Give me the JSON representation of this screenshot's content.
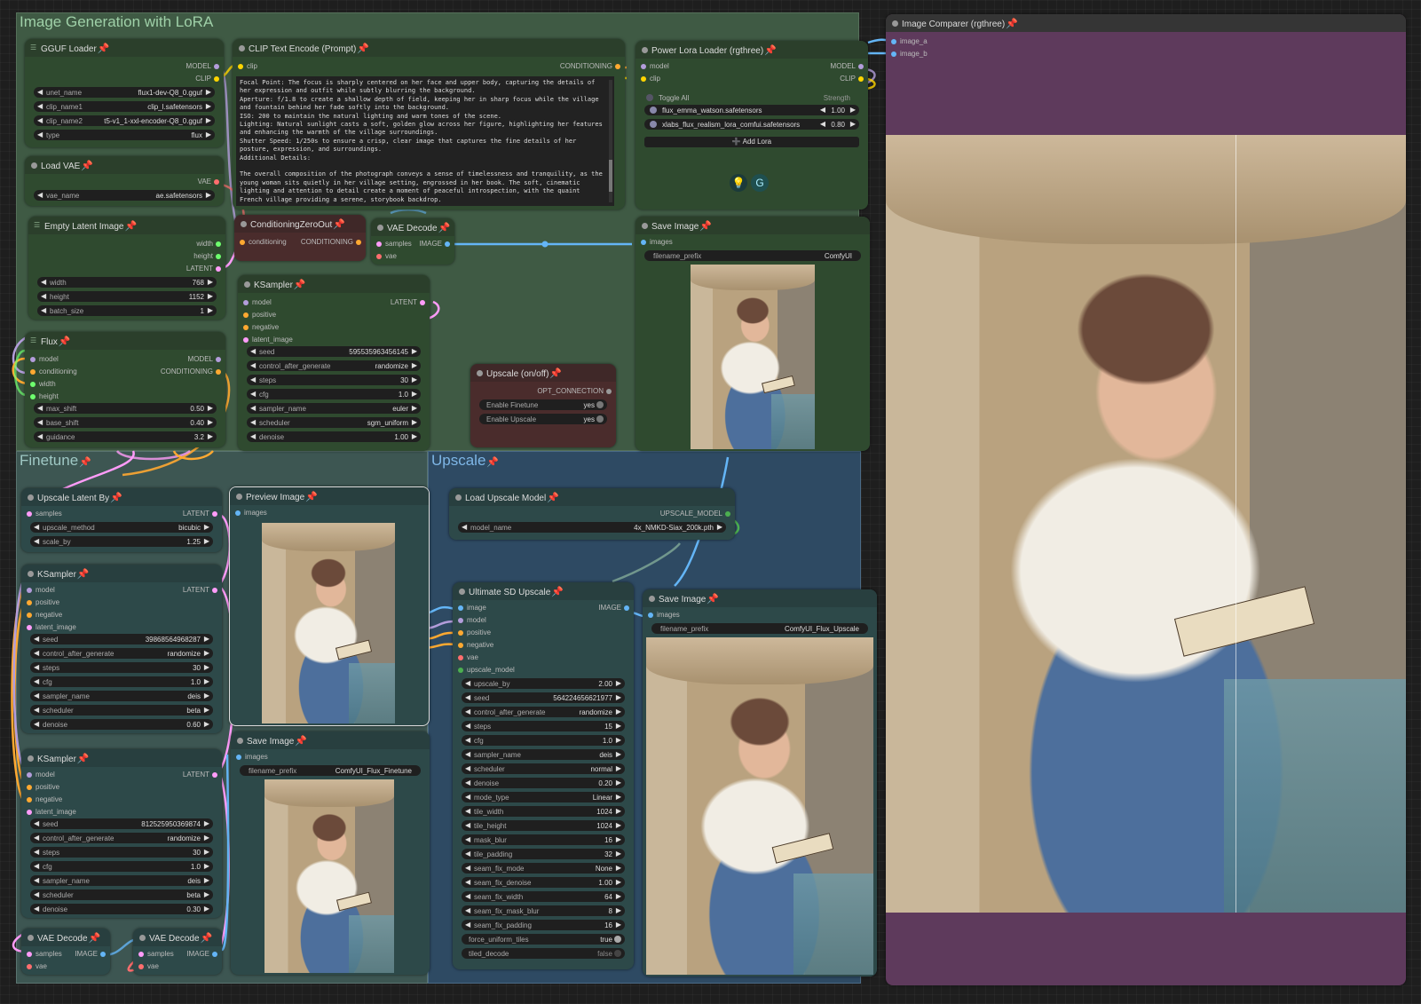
{
  "groups": {
    "main": {
      "title": "Image Generation with LoRA",
      "color": "#3f5a44"
    },
    "finetune": {
      "title": "Finetune",
      "color": "#3d5652"
    },
    "upscale": {
      "title": "Upscale",
      "color": "#2e4a63"
    }
  },
  "pin_icon": "pin-icon",
  "nodes": {
    "gguf": {
      "title": "GGUF Loader",
      "outputs": [
        "MODEL",
        "CLIP"
      ],
      "widgets": [
        {
          "k": "unet_name",
          "v": "flux1-dev-Q8_0.gguf"
        },
        {
          "k": "clip_name1",
          "v": "clip_l.safetensors"
        },
        {
          "k": "clip_name2",
          "v": "t5-v1_1-xxl-encoder-Q8_0.gguf"
        },
        {
          "k": "type",
          "v": "flux"
        }
      ]
    },
    "vae": {
      "title": "Load VAE",
      "outputs": [
        "VAE"
      ],
      "widgets": [
        {
          "k": "vae_name",
          "v": "ae.safetensors"
        }
      ]
    },
    "empty_latent": {
      "title": "Empty Latent Image",
      "outputs": [
        "width",
        "height",
        "LATENT"
      ],
      "widgets": [
        {
          "k": "width",
          "v": "768"
        },
        {
          "k": "height",
          "v": "1152"
        },
        {
          "k": "batch_size",
          "v": "1"
        }
      ]
    },
    "flux": {
      "title": "Flux",
      "inputs": [
        "model",
        "conditioning",
        "width",
        "height"
      ],
      "outputs": [
        "MODEL",
        "CONDITIONING"
      ],
      "widgets": [
        {
          "k": "max_shift",
          "v": "0.50"
        },
        {
          "k": "base_shift",
          "v": "0.40"
        },
        {
          "k": "guidance",
          "v": "3.2"
        }
      ]
    },
    "clip_text": {
      "title": "CLIP Text Encode (Prompt)",
      "input": "clip",
      "output": "CONDITIONING",
      "text": "Focal Point: The focus is sharply centered on her face and upper body, capturing the details of her expression and outfit while subtly blurring the background.\nAperture: f/1.8 to create a shallow depth of field, keeping her in sharp focus while the village and fountain behind her fade softly into the background.\nISO: 200 to maintain the natural lighting and warm tones of the scene.\nLighting: Natural sunlight casts a soft, golden glow across her figure, highlighting her features and enhancing the warmth of the village surroundings.\nShutter Speed: 1/250s to ensure a crisp, clear image that captures the fine details of her posture, expression, and surroundings.\nAdditional Details:\n\nThe overall composition of the photograph conveys a sense of timelessness and tranquility, as the young woman sits quietly in her village setting, engrossed in her book. The soft, cinematic lighting and attention to detail create a moment of peaceful introspection, with the quaint French village providing a serene, storybook backdrop."
    },
    "cond_zero": {
      "title": "ConditioningZeroOut",
      "input": "conditioning",
      "output": "CONDITIONING"
    },
    "vae_decode_main": {
      "title": "VAE Decode",
      "inputs": [
        "samples",
        "vae"
      ],
      "output": "IMAGE"
    },
    "ksampler_main": {
      "title": "KSampler",
      "inputs": [
        "model",
        "positive",
        "negative",
        "latent_image"
      ],
      "output": "LATENT",
      "widgets": [
        {
          "k": "seed",
          "v": "595535963456145"
        },
        {
          "k": "control_after_generate",
          "v": "randomize"
        },
        {
          "k": "steps",
          "v": "30"
        },
        {
          "k": "cfg",
          "v": "1.0"
        },
        {
          "k": "sampler_name",
          "v": "euler"
        },
        {
          "k": "scheduler",
          "v": "sgm_uniform"
        },
        {
          "k": "denoise",
          "v": "1.00"
        }
      ]
    },
    "upscale_switch": {
      "title": "Upscale (on/off)",
      "output": "OPT_CONNECTION",
      "widgets": [
        {
          "k": "Enable Finetune",
          "v": "yes"
        },
        {
          "k": "Enable Upscale",
          "v": "yes"
        }
      ]
    },
    "lora": {
      "title": "Power Lora Loader (rgthree)",
      "inputs": [
        "model",
        "clip"
      ],
      "outputs": [
        "MODEL",
        "CLIP"
      ],
      "toggle_all": "Toggle All",
      "strength_label": "Strength",
      "loras": [
        {
          "name": "flux_emma_watson.safetensors",
          "strength": "1.00"
        },
        {
          "name": "xlabs_flux_realism_lora_comfui.safetensors",
          "strength": "0.80"
        }
      ],
      "add_label": "➕ Add Lora"
    },
    "save_main": {
      "title": "Save Image",
      "input": "images",
      "widget": {
        "k": "filename_prefix",
        "v": "ComfyUI"
      }
    },
    "comparer": {
      "title": "Image Comparer (rgthree)",
      "inputs": [
        "image_a",
        "image_b"
      ]
    },
    "upscale_latent": {
      "title": "Upscale Latent By",
      "input": "samples",
      "output": "LATENT",
      "widgets": [
        {
          "k": "upscale_method",
          "v": "bicubic"
        },
        {
          "k": "scale_by",
          "v": "1.25"
        }
      ]
    },
    "ksampler_ft1": {
      "title": "KSampler",
      "inputs": [
        "model",
        "positive",
        "negative",
        "latent_image"
      ],
      "output": "LATENT",
      "widgets": [
        {
          "k": "seed",
          "v": "39868564968287"
        },
        {
          "k": "control_after_generate",
          "v": "randomize"
        },
        {
          "k": "steps",
          "v": "30"
        },
        {
          "k": "cfg",
          "v": "1.0"
        },
        {
          "k": "sampler_name",
          "v": "deis"
        },
        {
          "k": "scheduler",
          "v": "beta"
        },
        {
          "k": "denoise",
          "v": "0.60"
        }
      ]
    },
    "ksampler_ft2": {
      "title": "KSampler",
      "inputs": [
        "model",
        "positive",
        "negative",
        "latent_image"
      ],
      "output": "LATENT",
      "widgets": [
        {
          "k": "seed",
          "v": "812525950369874"
        },
        {
          "k": "control_after_generate",
          "v": "randomize"
        },
        {
          "k": "steps",
          "v": "30"
        },
        {
          "k": "cfg",
          "v": "1.0"
        },
        {
          "k": "sampler_name",
          "v": "deis"
        },
        {
          "k": "scheduler",
          "v": "beta"
        },
        {
          "k": "denoise",
          "v": "0.30"
        }
      ]
    },
    "vae_decode_ft1": {
      "title": "VAE Decode",
      "inputs": [
        "samples",
        "vae"
      ],
      "output": "IMAGE"
    },
    "vae_decode_ft2": {
      "title": "VAE Decode",
      "inputs": [
        "samples",
        "vae"
      ],
      "output": "IMAGE"
    },
    "preview": {
      "title": "Preview Image",
      "input": "images"
    },
    "save_ft": {
      "title": "Save Image",
      "input": "images",
      "widget": {
        "k": "filename_prefix",
        "v": "ComfyUI_Flux_Finetune"
      }
    },
    "load_upscale": {
      "title": "Load Upscale Model",
      "output": "UPSCALE_MODEL",
      "widget": {
        "k": "model_name",
        "v": "4x_NMKD-Siax_200k.pth"
      }
    },
    "ultimate": {
      "title": "Ultimate SD Upscale",
      "inputs": [
        "image",
        "model",
        "positive",
        "negative",
        "vae",
        "upscale_model"
      ],
      "output": "IMAGE",
      "widgets": [
        {
          "k": "upscale_by",
          "v": "2.00"
        },
        {
          "k": "seed",
          "v": "564224656621977"
        },
        {
          "k": "control_after_generate",
          "v": "randomize"
        },
        {
          "k": "steps",
          "v": "15"
        },
        {
          "k": "cfg",
          "v": "1.0"
        },
        {
          "k": "sampler_name",
          "v": "deis"
        },
        {
          "k": "scheduler",
          "v": "normal"
        },
        {
          "k": "denoise",
          "v": "0.20"
        },
        {
          "k": "mode_type",
          "v": "Linear"
        },
        {
          "k": "tile_width",
          "v": "1024"
        },
        {
          "k": "tile_height",
          "v": "1024"
        },
        {
          "k": "mask_blur",
          "v": "16"
        },
        {
          "k": "tile_padding",
          "v": "32"
        },
        {
          "k": "seam_fix_mode",
          "v": "None"
        },
        {
          "k": "seam_fix_denoise",
          "v": "1.00"
        },
        {
          "k": "seam_fix_width",
          "v": "64"
        },
        {
          "k": "seam_fix_mask_blur",
          "v": "8"
        },
        {
          "k": "seam_fix_padding",
          "v": "16"
        }
      ],
      "toggles": [
        {
          "k": "force_uniform_tiles",
          "v": "true"
        },
        {
          "k": "tiled_decode",
          "v": "false"
        }
      ]
    },
    "save_up": {
      "title": "Save Image",
      "input": "images",
      "widget": {
        "k": "filename_prefix",
        "v": "ComfyUI_Flux_Upscale"
      }
    }
  },
  "colors": {
    "model": "#b39ddb",
    "clip": "#ffd500",
    "conditioning": "#ffa931",
    "latent": "#ff9cf9",
    "vae": "#ff6e6e",
    "image": "#64b5f6",
    "upscale_model": "#4caf50",
    "int": "#6eff6e"
  }
}
